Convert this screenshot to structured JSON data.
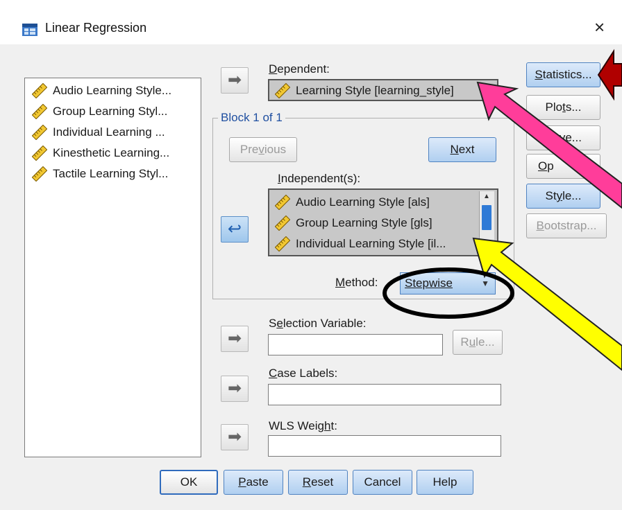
{
  "window": {
    "title": "Linear Regression",
    "close_glyph": "×",
    "icon": "spss-dialog-icon"
  },
  "variables": [
    {
      "label": "Audio Learning Style...",
      "icon": "scale-ruler-icon"
    },
    {
      "label": "Group Learning Styl...",
      "icon": "scale-ruler-icon"
    },
    {
      "label": "Individual Learning ...",
      "icon": "scale-ruler-icon"
    },
    {
      "label": "Kinesthetic Learning...",
      "icon": "scale-ruler-icon"
    },
    {
      "label": "Tactile Learning Styl...",
      "icon": "scale-ruler-icon"
    }
  ],
  "dependent": {
    "label_u": "D",
    "label_rest": "ependent:",
    "value": "Learning Style [learning_style]"
  },
  "block": {
    "legend": "Block 1 of 1",
    "previous_pre": "Pre",
    "previous_u": "v",
    "previous_post": "ious",
    "next_u": "N",
    "next_rest": "ext"
  },
  "independents": {
    "label_u": "I",
    "label_rest": "ndependent(s):",
    "items": [
      "Audio Learning Style [als]",
      "Group Learning Style  [gls]",
      "Individual Learning Style [il..."
    ]
  },
  "method": {
    "label_u": "M",
    "label_rest": "ethod:",
    "value": "Stepwise"
  },
  "selection": {
    "label_pre": "S",
    "label_u": "e",
    "label_rest": "lection Variable:",
    "rule_pre": "R",
    "rule_u": "u",
    "rule_rest": "le..."
  },
  "case_labels": {
    "label_u": "C",
    "label_rest": "ase Labels:"
  },
  "wls": {
    "label_pre": "WLS Weig",
    "label_u": "h",
    "label_rest": "t:"
  },
  "side_buttons": [
    {
      "u": "S",
      "rest": "tatistics...",
      "state": "blue"
    },
    {
      "pre": "Plo",
      "u": "t",
      "rest": "s...",
      "state": "normal"
    },
    {
      "pre": "S",
      "u": "a",
      "rest": "ve...",
      "state": "normal"
    },
    {
      "u": "O",
      "rest": "p",
      "state": "normal"
    },
    {
      "pre": "St",
      "u": "y",
      "rest": "le...",
      "state": "blue"
    },
    {
      "u": "B",
      "rest": "ootstrap...",
      "state": "disabled"
    }
  ],
  "bottom_buttons": [
    {
      "pre": "OK",
      "u": "",
      "rest": "",
      "state": "default"
    },
    {
      "pre": "",
      "u": "P",
      "rest": "aste",
      "state": "blue"
    },
    {
      "pre": "",
      "u": "R",
      "rest": "eset",
      "state": "blue"
    },
    {
      "pre": "Cancel",
      "u": "",
      "rest": "",
      "state": "blue"
    },
    {
      "pre": "Help",
      "u": "",
      "rest": "",
      "state": "blue"
    }
  ],
  "annotation_colors": {
    "red_arrow": "#b00000",
    "pink_arrow": "#ff3d9a",
    "yellow_arrow": "#ffff00",
    "circle": "#000000"
  }
}
